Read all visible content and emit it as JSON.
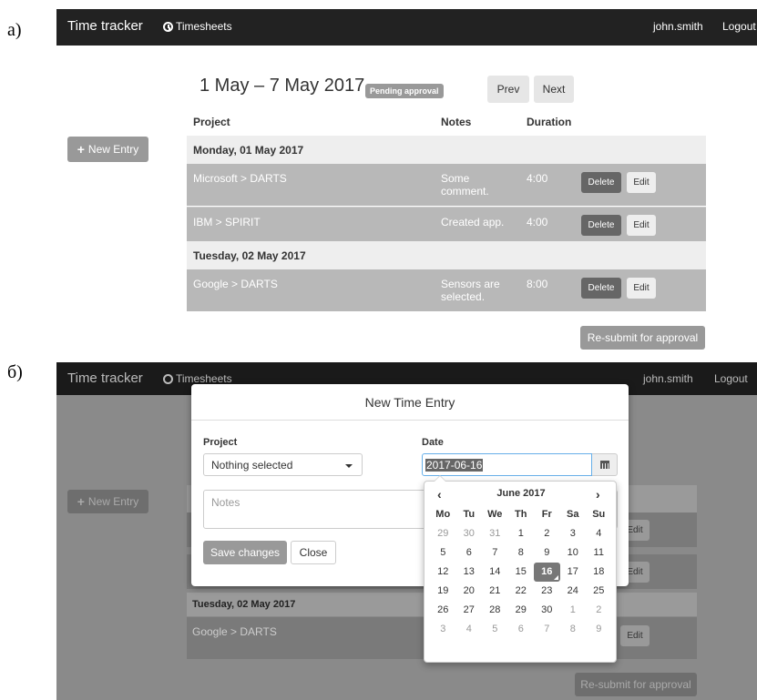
{
  "labels": {
    "a": "а)",
    "b": "б)"
  },
  "nav": {
    "brand": "Time tracker",
    "timesheets": "Timesheets",
    "user": "john.smith",
    "logout": "Logout"
  },
  "week": {
    "title": "1 May – 7 May 2017",
    "status": "Pending approval",
    "prev": "Prev",
    "next": "Next"
  },
  "new_entry": "New Entry",
  "table": {
    "headers": {
      "project": "Project",
      "notes": "Notes",
      "duration": "Duration"
    },
    "days": [
      {
        "label": "Monday, 01 May 2017",
        "entries": [
          {
            "project": "Microsoft > DARTS",
            "notes": "Some comment.",
            "duration": "4:00"
          },
          {
            "project": "IBM > SPIRIT",
            "notes": "Created app.",
            "duration": "4:00"
          }
        ]
      },
      {
        "label": "Tuesday, 02 May 2017",
        "entries": [
          {
            "project": "Google > DARTS",
            "notes": "Sensors are selected.",
            "duration": "8:00"
          }
        ]
      }
    ],
    "delete_label": "Delete",
    "edit_label": "Edit"
  },
  "resubmit": "Re-submit for approval",
  "modal": {
    "title": "New Time Entry",
    "project_label": "Project",
    "project_value": "Nothing selected",
    "date_label": "Date",
    "date_value": "2017-06-16",
    "notes_placeholder": "Notes",
    "save": "Save changes",
    "close": "Close"
  },
  "datepicker": {
    "prev": "‹",
    "next": "›",
    "month": "June 2017",
    "weekdays": [
      "Mo",
      "Tu",
      "We",
      "Th",
      "Fr",
      "Sa",
      "Su"
    ],
    "weeks": [
      [
        "29",
        "30",
        "31",
        "1",
        "2",
        "3",
        "4"
      ],
      [
        "5",
        "6",
        "7",
        "8",
        "9",
        "10",
        "11"
      ],
      [
        "12",
        "13",
        "14",
        "15",
        "16",
        "17",
        "18"
      ],
      [
        "19",
        "20",
        "21",
        "22",
        "23",
        "24",
        "25"
      ],
      [
        "26",
        "27",
        "28",
        "29",
        "30",
        "1",
        "2"
      ],
      [
        "3",
        "4",
        "5",
        "6",
        "7",
        "8",
        "9"
      ]
    ],
    "selected": "16"
  }
}
